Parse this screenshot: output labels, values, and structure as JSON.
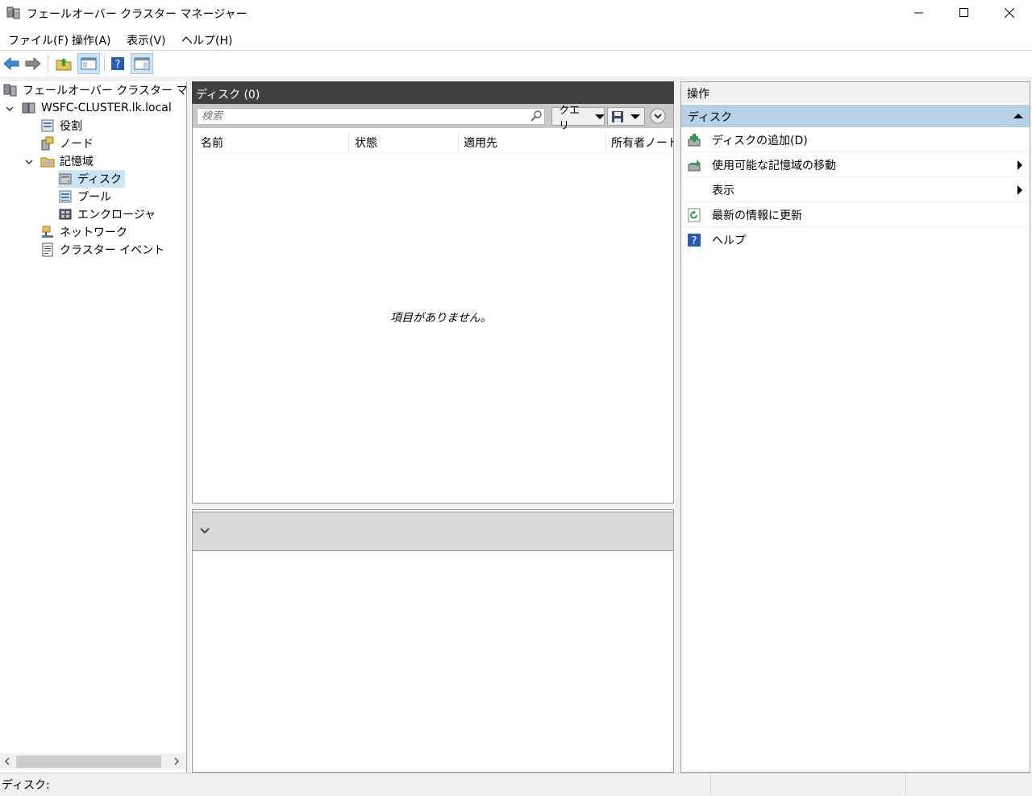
{
  "window": {
    "title": "フェールオーバー クラスター マネージャー"
  },
  "menu": [
    "ファイル(F)",
    "操作(A)",
    "表示(V)",
    "ヘルプ(H)"
  ],
  "tree": {
    "root": "フェールオーバー クラスター マネージャ",
    "cluster": "WSFC-CLUSTER.lk.local",
    "roles": "役割",
    "nodes": "ノード",
    "storage": "記憶域",
    "disks": "ディスク",
    "pools": "プール",
    "enclosures": "エンクロージャ",
    "networks": "ネットワーク",
    "cluster_events": "クラスター イベント"
  },
  "center": {
    "title": "ディスク (0)",
    "search_placeholder": "検索",
    "query_label": "クエリ",
    "columns": [
      "名前",
      "状態",
      "適用先",
      "所有者ノード"
    ],
    "empty_message": "項目がありません。"
  },
  "actions": {
    "title": "操作",
    "section": "ディスク",
    "items": [
      {
        "label": "ディスクの追加(D)",
        "icon": "add-disk-icon",
        "submenu": false
      },
      {
        "label": "使用可能な記憶域の移動",
        "icon": "move-storage-icon",
        "submenu": true
      },
      {
        "label": "表示",
        "icon": "",
        "submenu": true
      },
      {
        "label": "最新の情報に更新",
        "icon": "refresh-icon",
        "submenu": false
      },
      {
        "label": "ヘルプ",
        "icon": "help-icon",
        "submenu": false
      }
    ]
  },
  "status": {
    "text": "ディスク:"
  },
  "colors": {
    "selection": "#cce4f7",
    "section_header": "#b8d1e6",
    "pane_header": "#404040"
  }
}
